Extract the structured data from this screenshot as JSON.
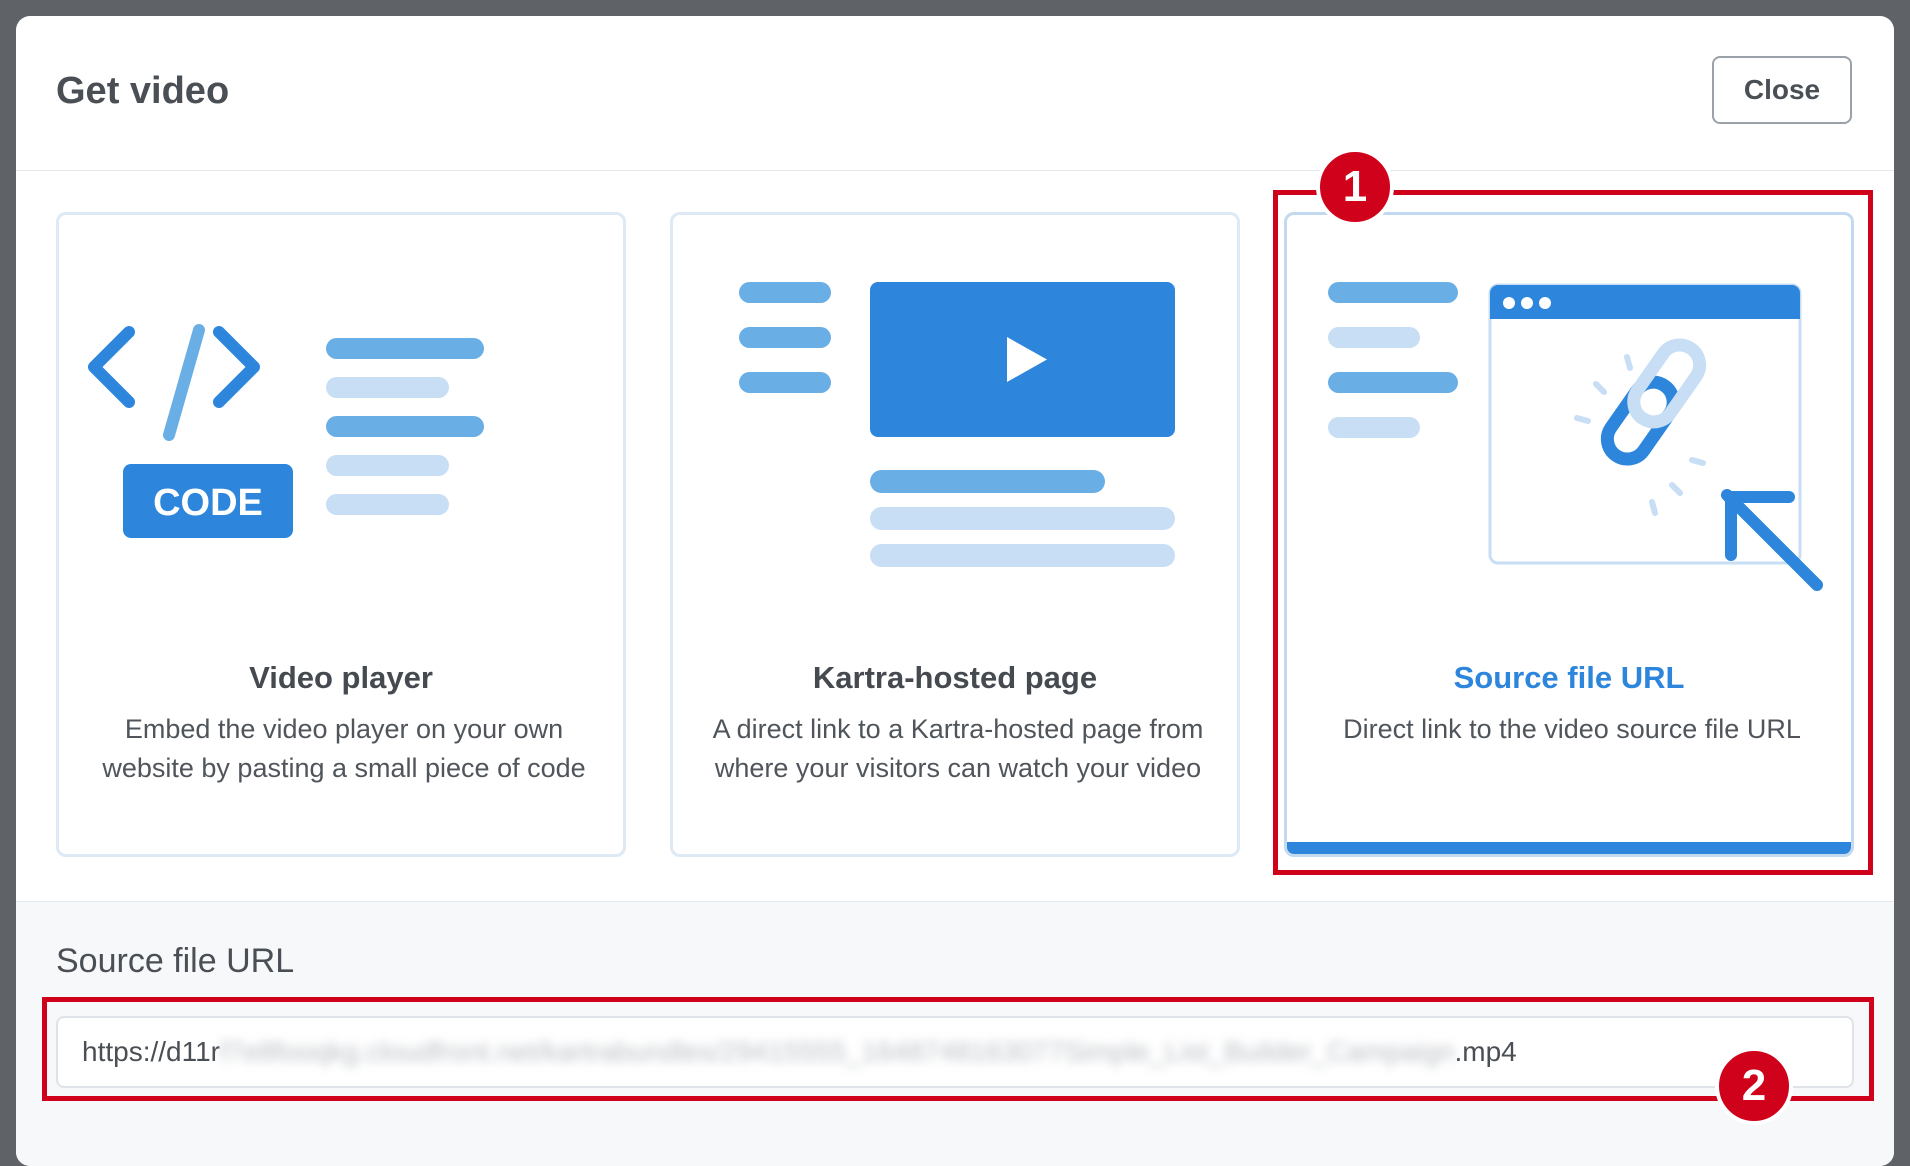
{
  "dialog": {
    "title": "Get video",
    "close_label": "Close"
  },
  "options": [
    {
      "title": "Video player",
      "description": "Embed the video player on your own website by pasting a small piece of code",
      "icon": "code-embed-icon",
      "icon_text": "CODE",
      "selected": false
    },
    {
      "title": "Kartra-hosted page",
      "description": "A direct link to a Kartra-hosted page from where your visitors can watch your video",
      "icon": "hosted-page-video-icon",
      "selected": false
    },
    {
      "title": "Source file URL",
      "description": "Direct link to the video source file URL",
      "icon": "link-cursor-icon",
      "selected": true
    }
  ],
  "source": {
    "label": "Source file URL",
    "url_start": "https://d11r",
    "url_hidden": "f7e8fooqkg.cloudfront.net/kartrabundles/29415555_1648748163077Simple_List_Builder_Campaign",
    "url_end": ".mp4"
  },
  "annotations": {
    "marker_1": "1",
    "marker_2": "2"
  },
  "colors": {
    "accent": "#2d86dc",
    "annotation": "#d0021b"
  }
}
